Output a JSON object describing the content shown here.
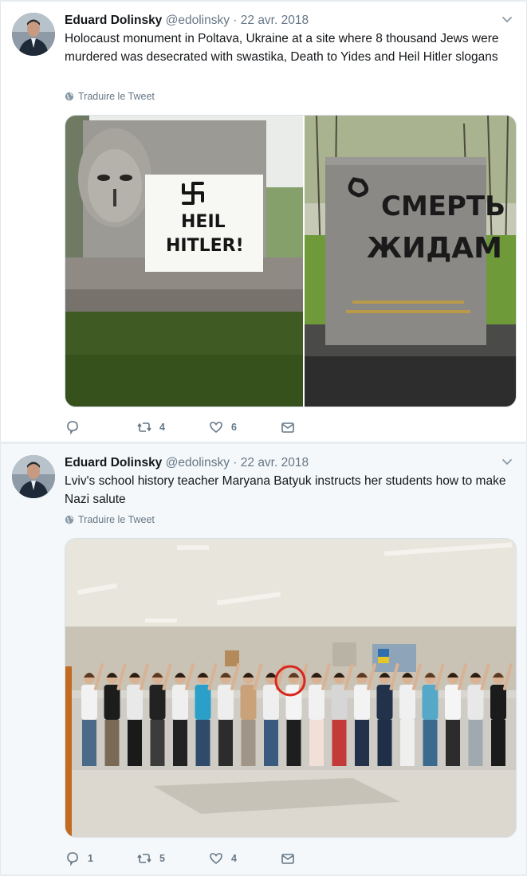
{
  "tweets": [
    {
      "author_name": "Eduard Dolinsky",
      "handle": "@edolinsky",
      "date_sep": " · ",
      "date": "22 avr. 2018",
      "text": "Holocaust monument in Poltava, Ukraine at a site where 8 thousand Jews were murdered was desecrated with swastika, Death to Yides and Heil Hitler slogans",
      "translate_label": "Traduire le Tweet",
      "photo_left_graffiti": [
        "卐",
        "HEIL",
        "HITLER!"
      ],
      "photo_right_graffiti": [
        "СМЕРТЬ",
        "ЖИДАМ"
      ],
      "reply_count": "",
      "retweet_count": "4",
      "like_count": "6"
    },
    {
      "author_name": "Eduard Dolinsky",
      "handle": "@edolinsky",
      "date_sep": " · ",
      "date": "22 avr. 2018",
      "text": "Lviv's school history teacher Maryana Batyuk instructs her students how to make Nazi salute",
      "translate_label": "Traduire le Tweet",
      "reply_count": "1",
      "retweet_count": "5",
      "like_count": "4"
    }
  ],
  "colors": {
    "text": "#14171a",
    "secondary": "#657786",
    "border": "#e1e8ed"
  }
}
